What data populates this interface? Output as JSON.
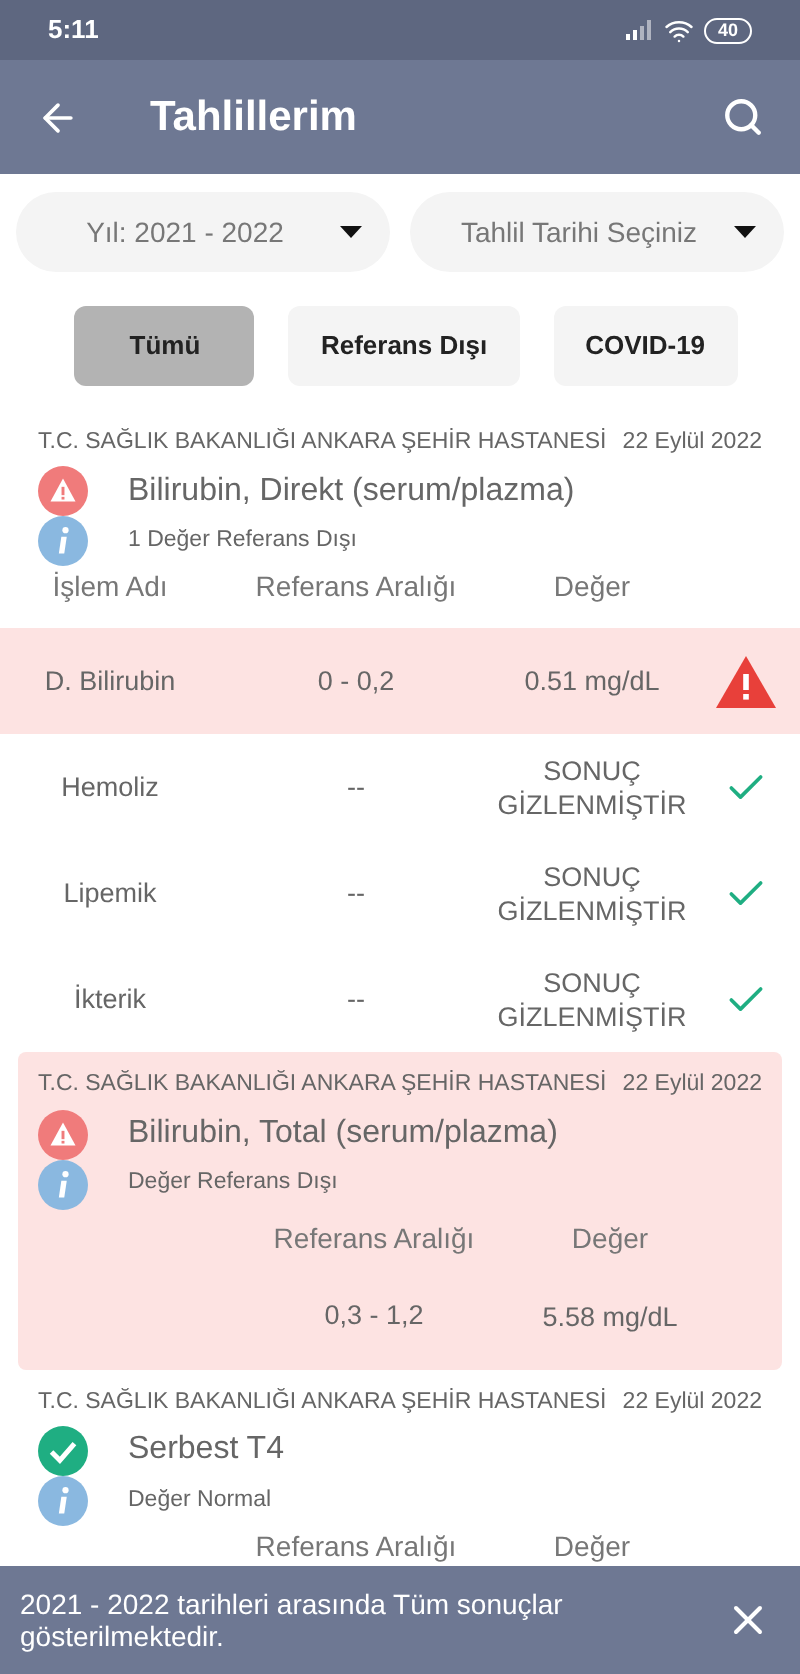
{
  "status_bar": {
    "time": "5:11",
    "battery": "40"
  },
  "app_bar": {
    "title": "Tahlillerim"
  },
  "dropdowns": [
    {
      "value": "Yıl: 2021 - 2022"
    },
    {
      "value": "Tahlil Tarihi Seçiniz"
    }
  ],
  "filters": [
    {
      "label": "Tümü",
      "selected": true
    },
    {
      "label": "Referans Dışı",
      "selected": false
    },
    {
      "label": "COVID-19",
      "selected": false
    }
  ],
  "results": [
    {
      "hospital": "T.C. SAĞLIK BAKANLIĞI ANKARA ŞEHİR HASTANESİ",
      "date": "22 Eylül 2022",
      "kind": "abnormal",
      "highlighted": false,
      "title": "Bilirubin, Direkt (serum/plazma)",
      "note": "1 Değer Referans Dışı",
      "columns": {
        "name": "İşlem Adı",
        "range": "Referans Aralığı",
        "value": "Değer"
      },
      "rows": [
        {
          "name": "D. Bilirubin",
          "range": "0 - 0,2",
          "value": "0.51 mg/dL",
          "out_of_range": true
        },
        {
          "name": "Hemoliz",
          "range": "--",
          "value": "SONUÇ GİZLENMİŞTİR",
          "out_of_range": false
        },
        {
          "name": "Lipemik",
          "range": "--",
          "value": "SONUÇ GİZLENMİŞTİR",
          "out_of_range": false
        },
        {
          "name": "İkterik",
          "range": "--",
          "value": "SONUÇ GİZLENMİŞTİR",
          "out_of_range": false
        }
      ]
    },
    {
      "hospital": "T.C. SAĞLIK BAKANLIĞI ANKARA ŞEHİR HASTANESİ",
      "date": "22 Eylül 2022",
      "kind": "abnormal",
      "highlighted": true,
      "title": "Bilirubin, Total (serum/plazma)",
      "note": "Değer Referans Dışı",
      "columns": {
        "range": "Referans Aralığı",
        "value": "Değer"
      },
      "rows": [
        {
          "range": "0,3 - 1,2",
          "value": "5.58 mg/dL"
        }
      ]
    },
    {
      "hospital": "T.C. SAĞLIK BAKANLIĞI ANKARA ŞEHİR HASTANESİ",
      "date": "22 Eylül 2022",
      "kind": "normal",
      "highlighted": false,
      "title": "Serbest T4",
      "note": "Değer Normal",
      "columns": {
        "range": "Referans Aralığı",
        "value": "Değer"
      }
    }
  ],
  "snackbar": {
    "message": "2021 - 2022 tarihleri arasında Tüm sonuçlar gösterilmektedir."
  }
}
